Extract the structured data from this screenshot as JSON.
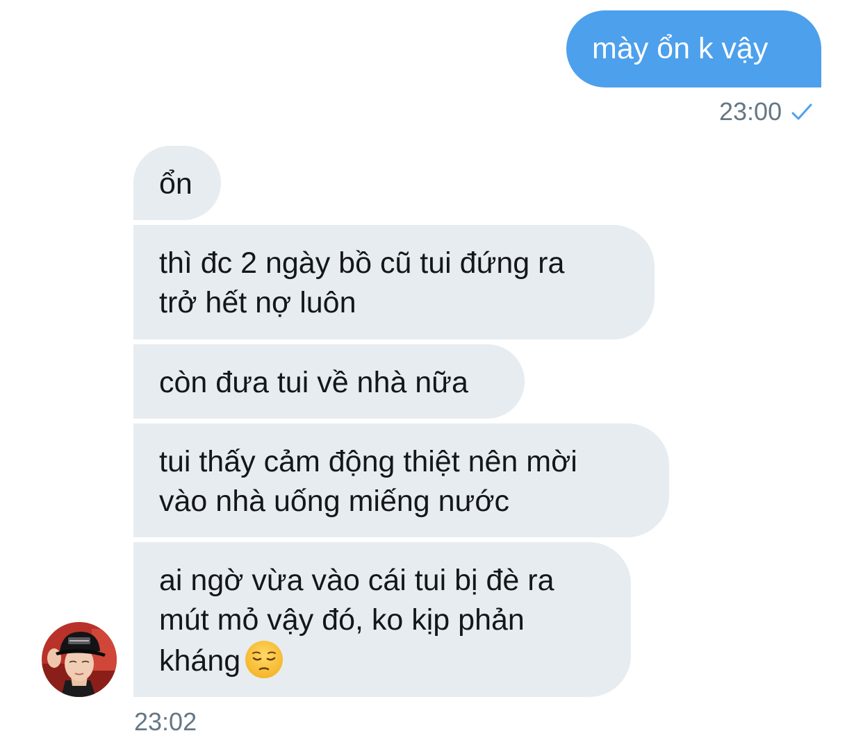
{
  "sent_message": {
    "text": "mày ổn k vậy",
    "time": "23:00",
    "status_icon": "check-icon",
    "bubble_color": "#4da0ec"
  },
  "received_messages": [
    {
      "lines": [
        "ổn"
      ]
    },
    {
      "lines": [
        "thì đc 2 ngày bồ cũ tui đứng ra",
        "trở hết nợ luôn"
      ]
    },
    {
      "lines": [
        "còn đưa tui về nhà nữa"
      ]
    },
    {
      "lines": [
        "tui thấy cảm động thiệt nên mời",
        "vào nhà uống miếng nước"
      ]
    },
    {
      "lines": [
        "ai ngờ vừa vào cái tui bị đè ra",
        "mút mỏ vậy đó, ko kịp phản",
        "kháng"
      ],
      "trailing_icon": "pensive-face-emoji"
    }
  ],
  "received_time": "23:02",
  "received_bubble_color": "#e6ecf0",
  "avatar_icon": "user-avatar"
}
